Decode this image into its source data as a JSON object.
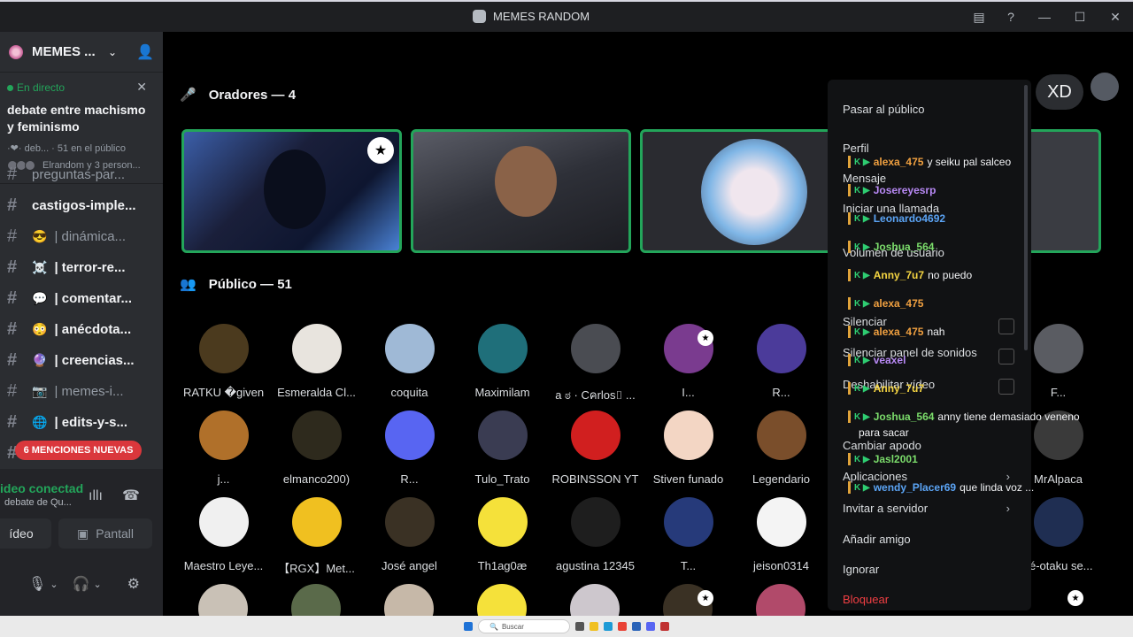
{
  "window": {
    "title": "MEMES RANDOM"
  },
  "server": {
    "name": "MEMES ..."
  },
  "live": {
    "tag": "En directo",
    "topic": "debate entre machismo y feminismo",
    "meta": "·❤·  deb...  ·  51 en el público",
    "people": "Elrandom y 3 person..."
  },
  "channels": [
    {
      "emoji": "",
      "label": "preguntas-par...",
      "bold": false
    },
    {
      "emoji": "",
      "label": "castigos-imple...",
      "bold": true
    },
    {
      "emoji": "😎",
      "label": "| dinámica...",
      "bold": false
    },
    {
      "emoji": "☠️",
      "label": "| terror-re...",
      "bold": true
    },
    {
      "emoji": "💬",
      "label": "| comentar...",
      "bold": true
    },
    {
      "emoji": "😳",
      "label": "| anécdota...",
      "bold": true
    },
    {
      "emoji": "🔮",
      "label": "| creencias...",
      "bold": true
    },
    {
      "emoji": "📷",
      "label": "| memes-i...",
      "bold": false
    },
    {
      "emoji": "🌐",
      "label": "| edits-y-s...",
      "bold": true
    },
    {
      "emoji": "🎬",
      "label": "| miniatura...",
      "bold": true
    }
  ],
  "mentions": "6 MENCIONES NUEVAS",
  "voice": {
    "status": "ideo conectad",
    "sub": "debate de Qu...",
    "video_label": "ídeo",
    "share_label": "Pantall"
  },
  "stage": {
    "speakers_title": "Oradores — 4",
    "audience_title": "Público — 51"
  },
  "topright": {
    "xd": "XD"
  },
  "audience": [
    {
      "name": "RATKU �given",
      "color": "#4b3a1e"
    },
    {
      "name": "Esmeralda Cl...",
      "color": "#e8e4de"
    },
    {
      "name": "coquita",
      "color": "#9fb9d6"
    },
    {
      "name": "Maximilam",
      "color": "#1f6f7a"
    },
    {
      "name": "a ಠ · Cคrlos⌷ ...",
      "color": "#4a4c52"
    },
    {
      "name": "I...",
      "color": "#7a3b8f"
    },
    {
      "name": "R...",
      "color": "#4b3b9a"
    },
    {
      "name": "j...",
      "color": "#b0702a"
    },
    {
      "name": "elmanco200)",
      "color": "#2e2a1d"
    },
    {
      "name": "R...",
      "color": "#5865f2"
    },
    {
      "name": "Tulo_Trato",
      "color": "#3a3c52"
    },
    {
      "name": "ROBINSSON YT",
      "color": "#d11f1f"
    },
    {
      "name": "Stiven funado",
      "color": "#f3d6c4"
    },
    {
      "name": "Legendario",
      "color": "#7a4e2b"
    },
    {
      "name": "Maestro Leye...",
      "color": "#f0f0f0"
    },
    {
      "name": "【RGX】Met...",
      "color": "#f0c020"
    },
    {
      "name": "José angel",
      "color": "#3a3124"
    },
    {
      "name": "Th1ag0æ",
      "color": "#f5e13a"
    },
    {
      "name": "agustina 12345",
      "color": "#1e1e1e"
    },
    {
      "name": "T...",
      "color": "#263a7a"
    },
    {
      "name": "jeison0314",
      "color": "#f4f4f4"
    }
  ],
  "audience_right": [
    {
      "name": "F...",
      "color": "#5a5c62"
    },
    {
      "name": "MrAlpaca",
      "color": "#3a3a3a"
    },
    {
      "name": "sé-otaku se...",
      "color": "#1f2e52"
    }
  ],
  "bottom_row_colors": [
    "#c9c1b6",
    "#5a6a4a",
    "#c6b8a8",
    "#f5e13a",
    "#cdc7cd",
    "#3a3124",
    "#b14a6a"
  ],
  "context_menu": {
    "items": [
      {
        "label": "Pasar al público",
        "danger": false
      },
      {
        "label": "Perfil",
        "danger": false
      },
      {
        "label": "Mensaje",
        "danger": false
      },
      {
        "label": "Iniciar una llamada",
        "danger": false
      },
      {
        "label": "Volumen de usuario",
        "danger": false
      },
      {
        "label": "Silenciar",
        "danger": false
      },
      {
        "label": "Silenciar panel de sonidos",
        "danger": false
      },
      {
        "label": "Deshabilitar vídeo",
        "danger": false
      },
      {
        "label": "Cambiar apodo",
        "danger": false
      },
      {
        "label": "Aplicaciones",
        "danger": false
      },
      {
        "label": "Invitar a servidor",
        "danger": false
      },
      {
        "label": "Añadir amigo",
        "danger": false
      },
      {
        "label": "Ignorar",
        "danger": false
      },
      {
        "label": "Bloquear",
        "danger": true
      }
    ]
  },
  "chat": [
    {
      "user": "alexa_475",
      "text": "y seiku pal salceo",
      "cls": "orange"
    },
    {
      "user": "Josereyesrp",
      "text": "",
      "cls": ""
    },
    {
      "user": "Leonardo4692",
      "text": "",
      "cls": "blue"
    },
    {
      "user": "Joshua_564",
      "text": "",
      "cls": "green"
    },
    {
      "user": "Anny_7u7",
      "text": "no puedo",
      "cls": "yellow"
    },
    {
      "user": "alexa_475",
      "text": "",
      "cls": "orange"
    },
    {
      "user": "alexa_475",
      "text": "nah",
      "cls": "orange"
    },
    {
      "user": "veaxel",
      "text": "",
      "cls": ""
    },
    {
      "user": "Anny_7u7",
      "text": "",
      "cls": "yellow"
    },
    {
      "user": "Joshua_564",
      "text": "anny tiene demasiado veneno",
      "cls": "green"
    },
    {
      "user": "",
      "text": "para sacar",
      "cls": ""
    },
    {
      "user": "Jasl2001",
      "text": "",
      "cls": "green"
    },
    {
      "user": "wendy_Placer69",
      "text": "que linda voz ...",
      "cls": "blue"
    }
  ],
  "taskbar": {
    "search": "Buscar"
  }
}
